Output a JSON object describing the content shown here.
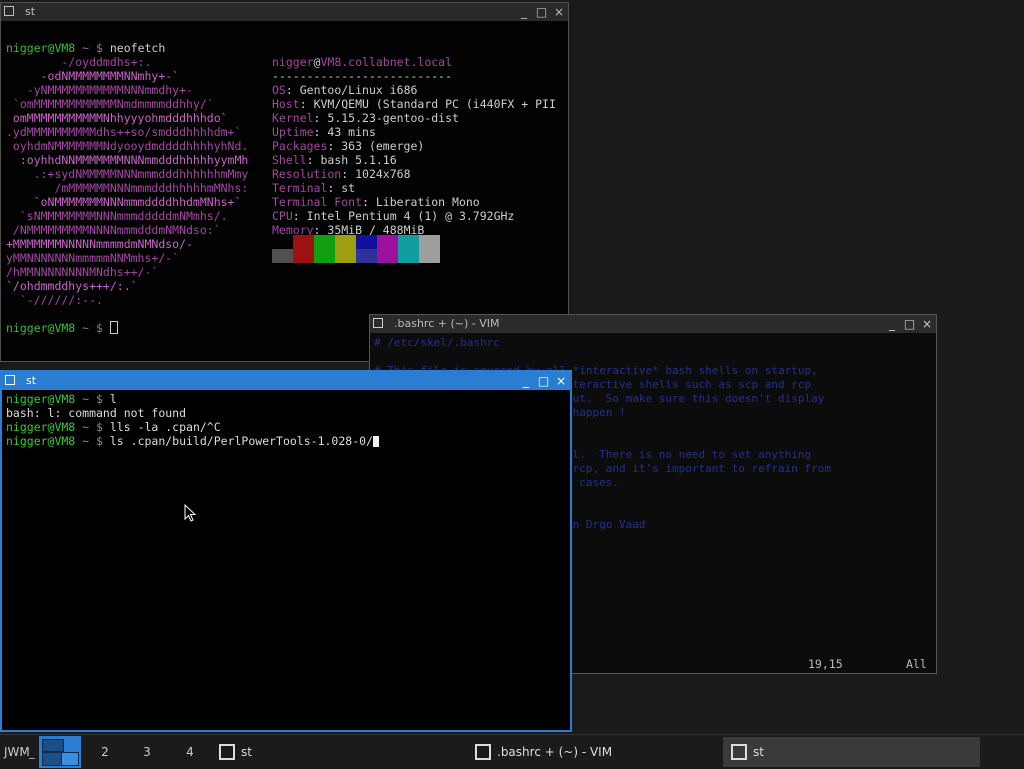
{
  "colors": {
    "accent": "#2a7dd1",
    "prompt_green": "#33cc33",
    "logo_magenta": "#b04ab0",
    "vim_text": "#23308f"
  },
  "win_top": {
    "title": "st",
    "buttons": [
      "_",
      "□",
      "×"
    ],
    "lines": [
      {
        "user": "nigger@VM8",
        "sep": " ~ $ ",
        "cmd": "neofetch"
      }
    ],
    "logo": [
      "        -/oyddmdhs+:.",
      "     -odNMMMMMMMMNNmhy+-`",
      "   -yNMMMMMMMMMMMNNNmmdhy+-",
      " `omMMMMMMMMMMMMNmdmmmmddhhy/`",
      " omMMMMMMMMMMMNhhyyyohmdddhhhdo`",
      ".ydMMMMMMMMMMdhs++so/smdddhhhhdm+`",
      " oyhdmNMMMMMMMNdyooydmddddhhhhyhNd.",
      "  :oyhhdNNMMMMMMMNNNmmdddhhhhhyymMh",
      "    .:+sydNMMMMMNNNmmmdddhhhhhhmMmy",
      "       /mMMMMMMNNNmmmdddhhhhhmMNhs:",
      "    `oNMMMMMMMNNNmmmddddhhdmMNhs+`",
      "  `sNMMMMMMMMNNNmmmdddddmNMmhs/.",
      " /NMMMMMMMMMNNNNmmmdddmNMNdso:`",
      "+MMMMMMMNNNNNmmmmdmNMNdso/-",
      "yMMNNNNNNNmmmmmNNMmhs+/-`",
      "/hMMNNNNNNNNMNdhs++/-`",
      "`/ohdmmddhys+++/:.`",
      "  `-//////:--."
    ],
    "info_header": {
      "user": "nigger",
      "at": "@",
      "host": "VM8.collabnet.local"
    },
    "divider": "--------------------------",
    "info": [
      {
        "key": "OS",
        "value": "Gentoo/Linux i686"
      },
      {
        "key": "Host",
        "value": "KVM/QEMU (Standard PC (i440FX + PII"
      },
      {
        "key": "Kernel",
        "value": "5.15.23-gentoo-dist"
      },
      {
        "key": "Uptime",
        "value": "43 mins"
      },
      {
        "key": "Packages",
        "value": "363 (emerge)"
      },
      {
        "key": "Shell",
        "value": "bash 5.1.16"
      },
      {
        "key": "Resolution",
        "value": "1024x768"
      },
      {
        "key": "Terminal",
        "value": "st"
      },
      {
        "key": "Terminal Font",
        "value": "Liberation Mono"
      },
      {
        "key": "CPU",
        "value": "Intel Pentium 4 (1) @ 3.792GHz"
      },
      {
        "key": "Memory",
        "value": "35MiB / 488MiB"
      }
    ],
    "swatches_top": [
      "#000000",
      "#aa1111",
      "#11aa11",
      "#aaaa11",
      "#1111aa",
      "#aa11aa",
      "#11aaaa",
      "#aaaaaa"
    ],
    "swatches_bottom": [
      "#555555",
      "#aa1111",
      "#11aa11",
      "#aaaa11",
      "#3333aa",
      "#aa11aa",
      "#11aaaa",
      "#aaaaaa"
    ],
    "last_prompt": {
      "user": "nigger@VM8",
      "sep": " ~ $ "
    }
  },
  "win_vim": {
    "title": ".bashrc + (~) - VIM",
    "buttons": [
      "_",
      "□",
      "×"
    ],
    "position": "19,15",
    "scroll": "All",
    "faded_lines": [
      "# /etc/skel/.bashrc",
      "",
      "# This file is sourced by all *interactive* bash shells on startup,",
      "# including some apparently interactive shells such as scp and rcp",
      "# that can't tolerate any output.  So make sure this doesn't display",
      "# anything or bad things will happen !",
      "",
      "",
      "# Test for an interactive shell.  There is no need to set anything",
      "# past this point for scp and rcp, and it's important to refrain from",
      "# outputting anything in those cases.",
      "",
      "",
      "# Put your fun stuff here.  Ben Drgo Vaad"
    ]
  },
  "win_active": {
    "title": "st",
    "buttons": [
      "_",
      "□",
      "×"
    ],
    "lines": [
      {
        "type": "prompt",
        "user": "nigger@VM8",
        "sep": " ~ $ ",
        "cmd": "l"
      },
      {
        "type": "out",
        "text": "bash: l: command not found"
      },
      {
        "type": "prompt",
        "user": "nigger@VM8",
        "sep": " ~ $ ",
        "cmd": "lls -la .cpan/^C"
      },
      {
        "type": "prompt",
        "user": "nigger@VM8",
        "sep": " ~ $ ",
        "cmd": "ls .cpan/build/PerlPowerTools-1.028-0/"
      }
    ]
  },
  "taskbar": {
    "wm_label": "JWM",
    "dash": "_",
    "workspaces": [
      "2",
      "3",
      "4"
    ],
    "tasks": [
      "st",
      ".bashrc + (~) - VIM",
      "st"
    ]
  }
}
